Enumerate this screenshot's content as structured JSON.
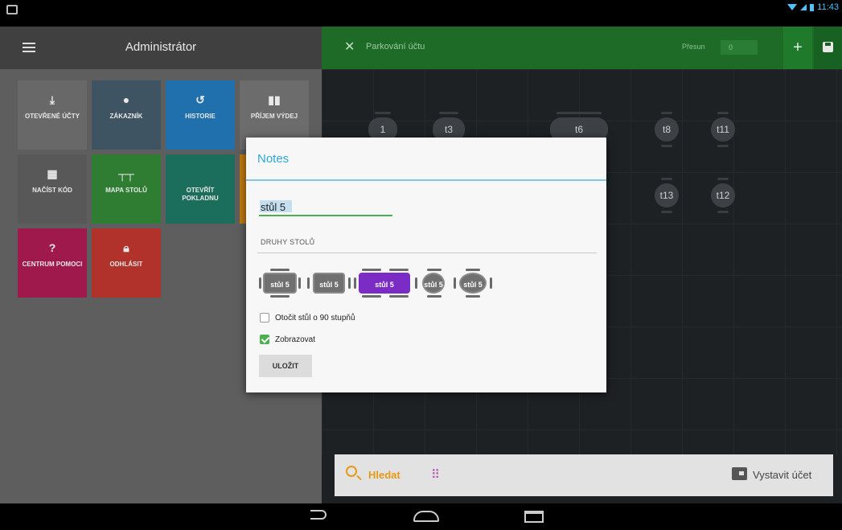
{
  "status": {
    "time": "11:43"
  },
  "left": {
    "title": "Administrátor",
    "tiles": [
      {
        "label": "OTEVŘENÉ ÚČTY",
        "icon": "download-icon",
        "color": "#686868"
      },
      {
        "label": "ZÁKAZNÍK",
        "icon": "person-icon",
        "color": "#3f5462"
      },
      {
        "label": "HISTORIE",
        "icon": "history-icon",
        "color": "#1f70ad"
      },
      {
        "label": "PŘÍJEM VÝDEJ",
        "icon": "bar-chart-icon",
        "color": "#6c6c6c"
      },
      {
        "label": "NAČÍST KÓD",
        "icon": "qr-code-icon",
        "color": "#585858"
      },
      {
        "label": "MAPA STOLŮ",
        "icon": "table-icon",
        "color": "#2e7d32"
      },
      {
        "label": "OTEVŘÍT POKLADNU",
        "icon": "",
        "color": "#1b6e5b"
      },
      {
        "label": "",
        "icon": "",
        "color": "#bf7a12"
      },
      {
        "label": "CENTRUM POMOCI",
        "icon": "help-icon",
        "color": "#a0194c"
      },
      {
        "label": "ODHLÁSIT",
        "icon": "lock-icon",
        "color": "#b1322a"
      }
    ]
  },
  "right": {
    "title": "Parkování účtu",
    "presun_label": "Přesun",
    "presun_value": "0",
    "add": "+",
    "tables": [
      "1",
      "t3",
      "t6",
      "t8",
      "t11",
      "t13",
      "t12"
    ],
    "search": "Hledat",
    "invoice": "Vystavit účet"
  },
  "dialog": {
    "title": "Notes",
    "name_value": "stůl 5",
    "section": "DRUHY STOLŮ",
    "types": [
      "stůl 5",
      "stůl 5",
      "stůl 5",
      "stůl 5",
      "stůl 5"
    ],
    "rotate_label": "Otočit stůl o 90 stupňů",
    "rotate_checked": false,
    "show_label": "Zobrazovat",
    "show_checked": true,
    "save": "ULOŽIT"
  },
  "colors": {
    "accent": "#2fa7d6",
    "green_header": "#1d6b27",
    "selected_table": "#7b2cc4",
    "search": "#e39a16"
  }
}
